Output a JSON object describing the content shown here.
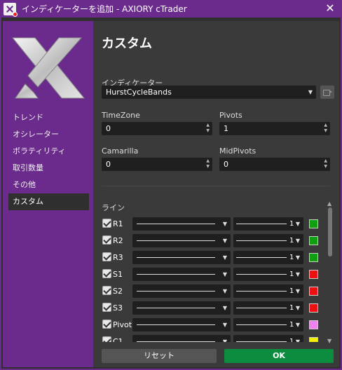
{
  "window": {
    "title": "インディケーターを追加 - AXIORY cTrader"
  },
  "sidebar": {
    "items": [
      {
        "label": "トレンド"
      },
      {
        "label": "オシレーター"
      },
      {
        "label": "ボラティリティ"
      },
      {
        "label": "取引数量"
      },
      {
        "label": "その他"
      },
      {
        "label": "カスタム",
        "active": true
      }
    ]
  },
  "main": {
    "title": "カスタム",
    "indicator_label": "インディケーター",
    "indicator_value": "HurstCycleBands",
    "fields": [
      {
        "label": "TimeZone",
        "value": "0"
      },
      {
        "label": "Pivots",
        "value": "1"
      },
      {
        "label": "Camarilla",
        "value": "0"
      },
      {
        "label": "MidPivots",
        "value": "0"
      }
    ],
    "lines_label": "ライン",
    "lines": [
      {
        "name": "R1",
        "width": "1",
        "color": "#10a010"
      },
      {
        "name": "R2",
        "width": "1",
        "color": "#10a010"
      },
      {
        "name": "R3",
        "width": "1",
        "color": "#10a010"
      },
      {
        "name": "S1",
        "width": "1",
        "color": "#ee1111"
      },
      {
        "name": "S2",
        "width": "1",
        "color": "#ee1111"
      },
      {
        "name": "S3",
        "width": "1",
        "color": "#ee1111"
      },
      {
        "name": "Pivot",
        "width": "1",
        "color": "#ee82ee"
      },
      {
        "name": "C1",
        "width": "1",
        "color": "#f0f000"
      }
    ]
  },
  "buttons": {
    "reset": "リセット",
    "ok": "OK"
  }
}
